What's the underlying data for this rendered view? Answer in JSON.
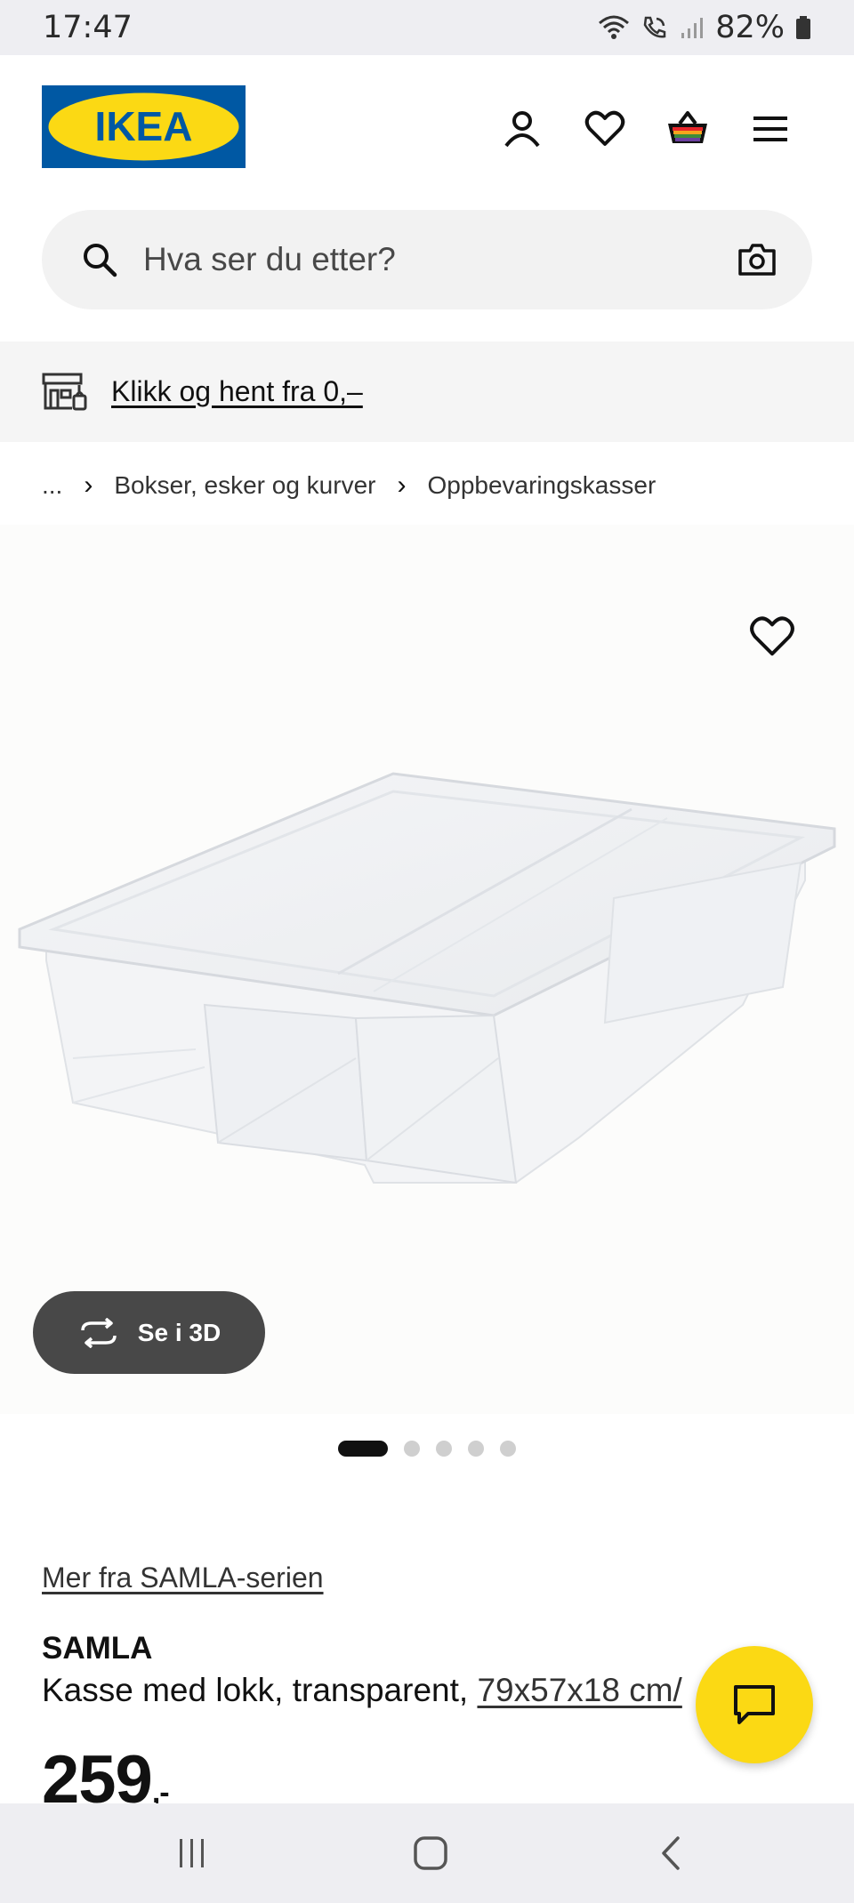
{
  "status_bar": {
    "time": "17:47",
    "battery": "82%",
    "icons": [
      "wifi-icon",
      "call-icon",
      "signal-icon",
      "battery-icon"
    ]
  },
  "header": {
    "logo_text": "IKEA",
    "icons": [
      "account-icon",
      "favorites-heart-icon",
      "shopping-basket-icon",
      "menu-icon"
    ]
  },
  "search": {
    "placeholder": "Hva ser du etter?",
    "value": ""
  },
  "promo": {
    "label": "Klikk og hent fra 0,–"
  },
  "breadcrumb": {
    "items": [
      "...",
      "Bokser, esker og kurver",
      "Oppbevaringskasser"
    ]
  },
  "gallery": {
    "view_3d_label": "Se i 3D",
    "total_images": 5,
    "active_index": 0
  },
  "product": {
    "series_link": "Mer fra SAMLA-serien",
    "name": "SAMLA",
    "description": "Kasse med lokk, transparent,",
    "size_link": "79x57x18 cm/",
    "price": "259",
    "price_suffix": ",-"
  },
  "colors": {
    "ikea_blue": "#0058a3",
    "ikea_yellow": "#fbd914",
    "dark_button": "#484848"
  },
  "navbar": {
    "icons": [
      "recent-apps-icon",
      "home-icon",
      "back-icon"
    ]
  }
}
